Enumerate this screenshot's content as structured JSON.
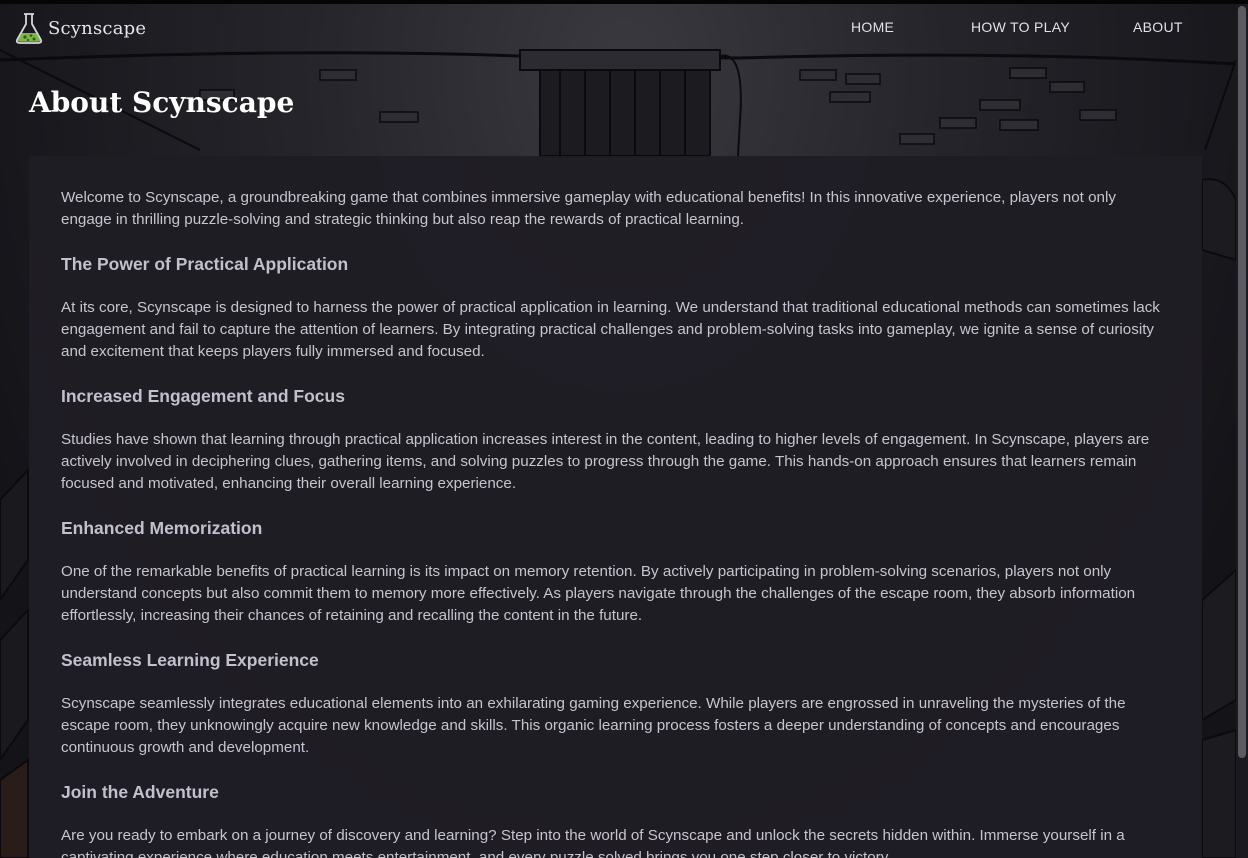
{
  "nav": {
    "brand": "Scynscape",
    "links": [
      "HOME",
      "HOW TO PLAY",
      "ABOUT"
    ]
  },
  "page": {
    "title": "About Scynscape"
  },
  "content": {
    "intro": "Welcome to Scynscape, a groundbreaking game that combines immersive gameplay with educational benefits! In this innovative experience, players not only engage in thrilling puzzle-solving and strategic thinking but also reap the rewards of practical learning.",
    "sections": [
      {
        "heading": "The Power of Practical Application",
        "body": "At its core, Scynscape is designed to harness the power of practical application in learning. We understand that traditional educational methods can sometimes lack engagement and fail to capture the attention of learners. By integrating practical challenges and problem-solving tasks into gameplay, we ignite a sense of curiosity and excitement that keeps players fully immersed and focused."
      },
      {
        "heading": "Increased Engagement and Focus",
        "body": "Studies have shown that learning through practical application increases interest in the content, leading to higher levels of engagement. In Scynscape, players are actively involved in deciphering clues, gathering items, and solving puzzles to progress through the game. This hands-on approach ensures that learners remain focused and motivated, enhancing their overall learning experience."
      },
      {
        "heading": "Enhanced Memorization",
        "body": "One of the remarkable benefits of practical learning is its impact on memory retention. By actively participating in problem-solving scenarios, players not only understand concepts but also commit them to memory more effectively. As players navigate through the challenges of the escape room, they absorb information effortlessly, increasing their chances of retaining and recalling the content in the future."
      },
      {
        "heading": "Seamless Learning Experience",
        "body": "Scynscape seamlessly integrates educational elements into an exhilarating gaming experience. While players are engrossed in unraveling the mysteries of the escape room, they unknowingly acquire new knowledge and skills. This organic learning process fosters a deeper understanding of concepts and encourages continuous growth and development."
      },
      {
        "heading": "Join the Adventure",
        "body": "Are you ready to embark on a journey of discovery and learning? Step into the world of Scynscape and unlock the secrets hidden within. Immerse yourself in a captivating experience where education meets entertainment, and every puzzle solved brings you one step closer to victory."
      }
    ]
  },
  "icons": {
    "brand": "flask-icon"
  },
  "colors": {
    "background": "#17151c",
    "panel": "#1f1d24",
    "text": "#c6c4cf",
    "heading": "#c2c0cc",
    "title": "#ffffff",
    "flask_liquid": "#8fd14f"
  }
}
